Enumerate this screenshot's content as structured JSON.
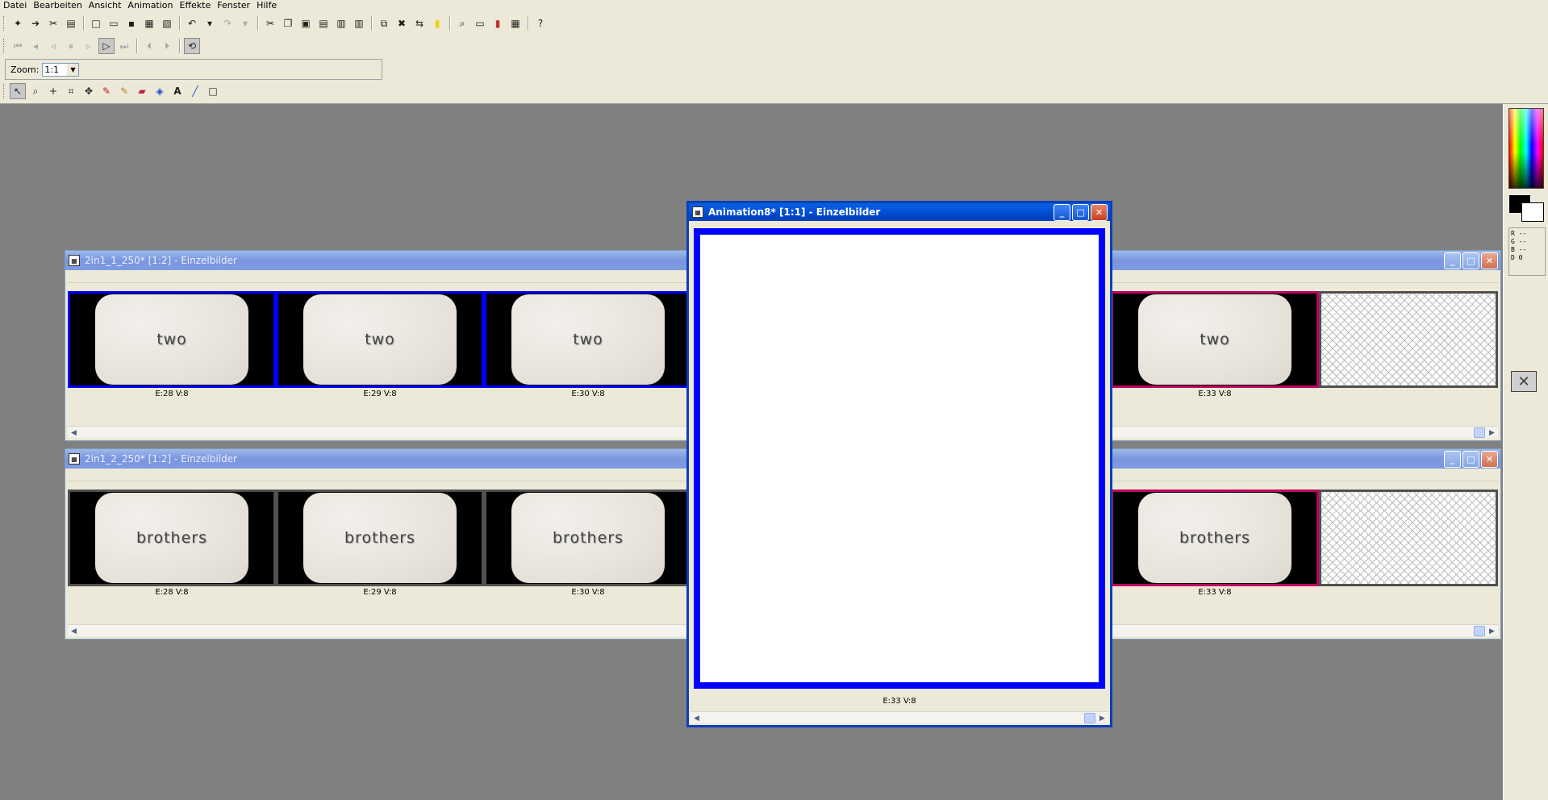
{
  "menu": [
    "Datei",
    "Bearbeiten",
    "Ansicht",
    "Animation",
    "Effekte",
    "Fenster",
    "Hilfe"
  ],
  "toolbar": {
    "zoom_label": "Zoom:",
    "zoom_value": "1:1"
  },
  "palette": {
    "rgb_lines": [
      "R --",
      "G --",
      "B --",
      "D 0"
    ]
  },
  "windows": {
    "strip1": {
      "title": "2in1_1_250* [1:2] - Einzelbilder",
      "frames": [
        {
          "text": "two",
          "label": "E:28  V:8"
        },
        {
          "text": "two",
          "label": "E:29  V:8"
        },
        {
          "text": "two",
          "label": "E:30  V:8"
        },
        {
          "text": "two",
          "label": "E:33  V:8"
        }
      ]
    },
    "strip2": {
      "title": "2in1_2_250* [1:2] - Einzelbilder",
      "frames": [
        {
          "text": "brothers",
          "label": "E:28  V:8"
        },
        {
          "text": "brothers",
          "label": "E:29  V:8"
        },
        {
          "text": "brothers",
          "label": "E:30  V:8"
        },
        {
          "text": "brothers",
          "label": "E:33  V:8"
        }
      ]
    },
    "animation": {
      "title": "Animation8* [1:1] - Einzelbilder",
      "label": "E:33  V:8"
    }
  },
  "colors": {
    "frame_border_selected": "#0000ff",
    "frame_border_current": "#c00060",
    "workspace": "#808080"
  }
}
